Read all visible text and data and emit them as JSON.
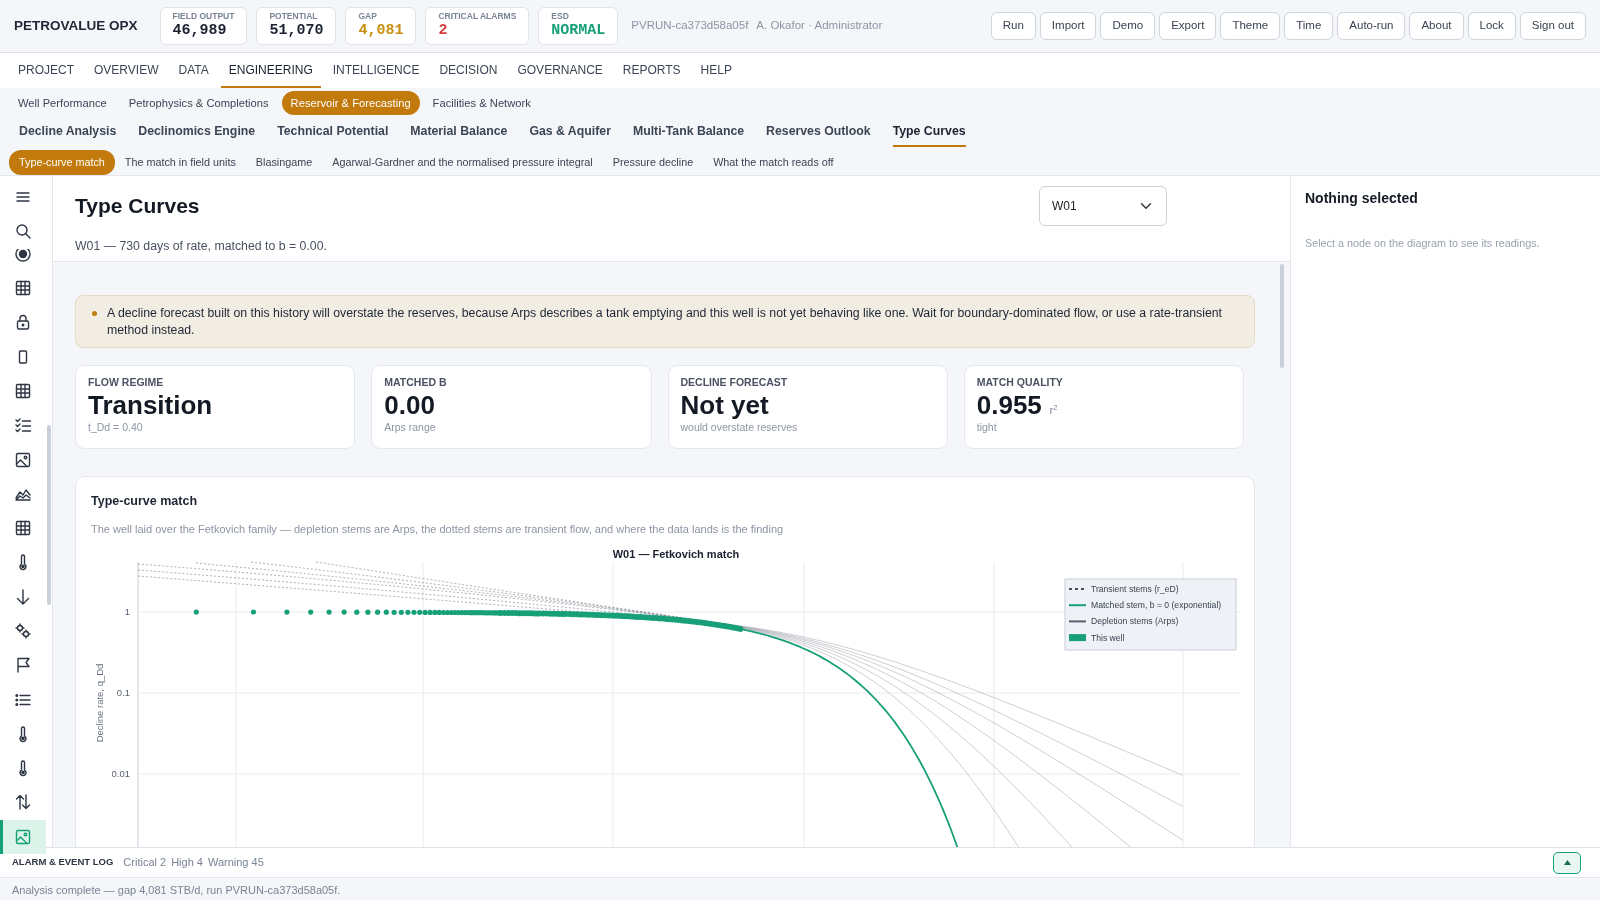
{
  "topbar": {
    "brand": "PETROVALUE OPX",
    "kpis": [
      {
        "label": "FIELD OUTPUT",
        "value": "46,989",
        "color": "#1b2230"
      },
      {
        "label": "POTENTIAL",
        "value": "51,070",
        "color": "#1b2230"
      },
      {
        "label": "GAP",
        "value": "4,081",
        "color": "#c8900e"
      },
      {
        "label": "CRITICAL ALARMS",
        "value": "2",
        "color": "#d63b3b"
      },
      {
        "label": "ESD",
        "value": "NORMAL",
        "color": "#17a078"
      }
    ],
    "run_id": "PVRUN-ca373d58a05f",
    "user": "A. Okafor · Administrator",
    "buttons": [
      "Run",
      "Import",
      "Demo",
      "Export",
      "Theme",
      "Time",
      "Auto-run",
      "About",
      "Lock",
      "Sign out"
    ]
  },
  "main_nav": [
    {
      "label": "PROJECT",
      "selected": false
    },
    {
      "label": "OVERVIEW",
      "selected": false
    },
    {
      "label": "DATA",
      "selected": false
    },
    {
      "label": "ENGINEERING",
      "selected": true
    },
    {
      "label": "INTELLIGENCE",
      "selected": false
    },
    {
      "label": "DECISION",
      "selected": false
    },
    {
      "label": "GOVERNANCE",
      "selected": false
    },
    {
      "label": "REPORTS",
      "selected": false
    },
    {
      "label": "HELP",
      "selected": false
    }
  ],
  "section_tabs": [
    {
      "label": "Well Performance",
      "selected": false
    },
    {
      "label": "Petrophysics & Completions",
      "selected": false
    },
    {
      "label": "Reservoir & Forecasting",
      "selected": true
    },
    {
      "label": "Facilities & Network",
      "selected": false
    }
  ],
  "page_tabs": [
    {
      "label": "Decline Analysis",
      "selected": false
    },
    {
      "label": "Declinomics Engine",
      "selected": false
    },
    {
      "label": "Technical Potential",
      "selected": false
    },
    {
      "label": "Material Balance",
      "selected": false
    },
    {
      "label": "Gas & Aquifer",
      "selected": false
    },
    {
      "label": "Multi-Tank Balance",
      "selected": false
    },
    {
      "label": "Reserves Outlook",
      "selected": false
    },
    {
      "label": "Type Curves",
      "selected": true
    }
  ],
  "view_tabs": [
    {
      "label": "Type-curve match",
      "selected": true
    },
    {
      "label": "The match in field units",
      "selected": false
    },
    {
      "label": "Blasingame",
      "selected": false
    },
    {
      "label": "Agarwal-Gardner and the normalised pressure integral",
      "selected": false
    },
    {
      "label": "Pressure decline",
      "selected": false
    },
    {
      "label": "What the match reads off",
      "selected": false
    }
  ],
  "sidebar": {
    "items": [
      {
        "selected": false
      },
      {
        "selected": false
      },
      {
        "selected": false
      },
      {
        "selected": false
      },
      {
        "selected": false
      },
      {
        "selected": false
      },
      {
        "selected": false
      },
      {
        "selected": false
      },
      {
        "selected": false
      },
      {
        "selected": false
      },
      {
        "selected": false
      },
      {
        "selected": false
      },
      {
        "selected": false
      },
      {
        "selected": false
      },
      {
        "selected": false
      },
      {
        "selected": false
      },
      {
        "selected": false
      },
      {
        "selected": true
      }
    ]
  },
  "page": {
    "title": "Type Curves",
    "subtitle": "W01 — 730 days of rate, matched to b = 0.00.",
    "well_select": {
      "value": "W01"
    }
  },
  "alert": {
    "text": "A decline forecast built on this history will overstate the reserves, because Arps describes a tank emptying and this well is not yet behaving like one. Wait for boundary-dominated flow, or use a rate-transient method instead."
  },
  "metrics": [
    {
      "label": "FLOW REGIME",
      "value": "Transition",
      "note": "t_Dd = 0.40"
    },
    {
      "label": "MATCHED B",
      "value": "0.00",
      "note": "Arps range"
    },
    {
      "label": "DECLINE FORECAST",
      "value": "Not yet",
      "note": "would overstate reserves"
    },
    {
      "label": "MATCH QUALITY",
      "value": "0.955",
      "unit": "r$^{2}$",
      "note": "tight"
    }
  ],
  "chart_card": {
    "title": "Type-curve match",
    "caption": "The well laid over the Fetkovich family — depletion stems are Arps, the dotted stems are transient flow, and where the data lands is the finding",
    "plot": {
      "title": "W01 — Fetkovich match",
      "ylabel": "Decline rate, q_Dd",
      "yticks": [
        "1",
        "0.1",
        "0.01"
      ],
      "legend": [
        {
          "label": "Transient stems (r_eD)",
          "kind": "dashed",
          "color": "#4a5060"
        },
        {
          "label": "Matched stem, b = 0 (exponential)",
          "kind": "line",
          "color": "#17a078"
        },
        {
          "label": "Depletion stems (Arps)",
          "kind": "line",
          "color": "#5a6070"
        },
        {
          "label": "This well",
          "kind": "block",
          "color": "#17a078"
        }
      ]
    }
  },
  "detail_panel": {
    "title": "Nothing selected",
    "hint": "Select a node on the diagram to see its readings."
  },
  "alarm_bar": {
    "title": "ALARM & EVENT LOG",
    "counts": [
      "Critical 2",
      "High 4",
      "Warning 45"
    ]
  },
  "status_bar": "Analysis complete — gap 4,081 STB/d, run PVRUN-ca373d58a05f."
}
